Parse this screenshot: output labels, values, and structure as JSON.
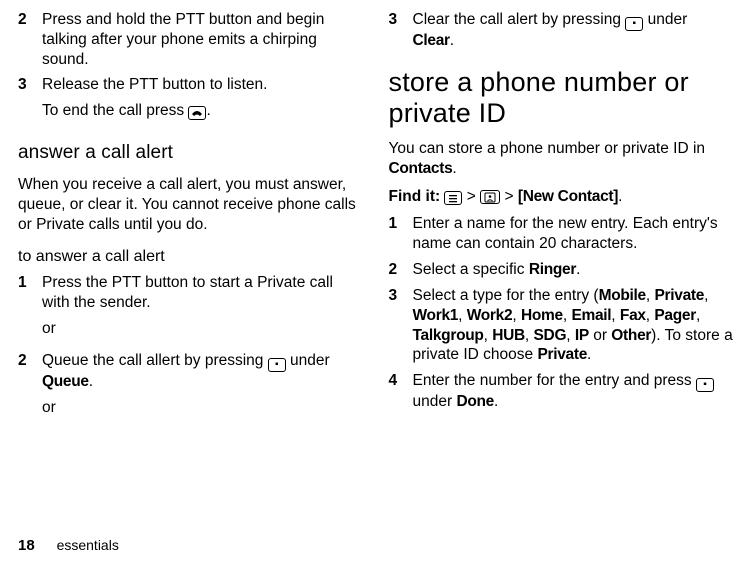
{
  "left": {
    "step2": "Press and hold the PTT button and begin talking after your phone emits a chirping sound.",
    "step3a": "Release the PTT button to listen.",
    "step3b_pre": "To end the call press ",
    "step3b_post": ".",
    "heading_answer": "answer a call alert",
    "answer_intro": "When you receive a call alert, you must answer, queue, or clear it. You cannot receive phone calls or Private calls until you do.",
    "heading_toanswer": "to answer a call alert",
    "a1": "Press the PTT button to start a Private call with the sender.",
    "or": "or",
    "a2_pre": "Queue the call allert by pressing ",
    "a2_post": " under ",
    "queue": "Queue",
    "dot": "."
  },
  "right": {
    "r3_pre": "Clear the call alert by pressing ",
    "r3_post": " under ",
    "clear": "Clear",
    "heading_store": "store a phone number or private ID",
    "store_intro_pre": "You can store a phone number or private ID in ",
    "contacts": "Contacts",
    "findit": "Find it:",
    "gt": ">",
    "newcontact": "[New Contact]",
    "s1": "Enter a name for the new entry. Each entry's name can contain 20 characters.",
    "s2_pre": "Select a specific ",
    "ringer": "Ringer",
    "s3_pre": "Select a type for the entry (",
    "types": [
      "Mobile",
      "Private",
      "Work1",
      "Work2",
      "Home",
      "Email",
      "Fax",
      "Pager",
      "Talkgroup",
      "HUB",
      "SDG",
      "IP"
    ],
    "or_word": " or ",
    "other": "Other",
    "s3_mid": "). To store a private ID choose ",
    "private": "Private",
    "s4_pre": "Enter the number for the entry and press ",
    "s4_post": " under ",
    "done": "Done"
  },
  "footer": {
    "page": "18",
    "section": "essentials"
  },
  "nums": {
    "n1": "1",
    "n2": "2",
    "n3": "3",
    "n4": "4"
  }
}
